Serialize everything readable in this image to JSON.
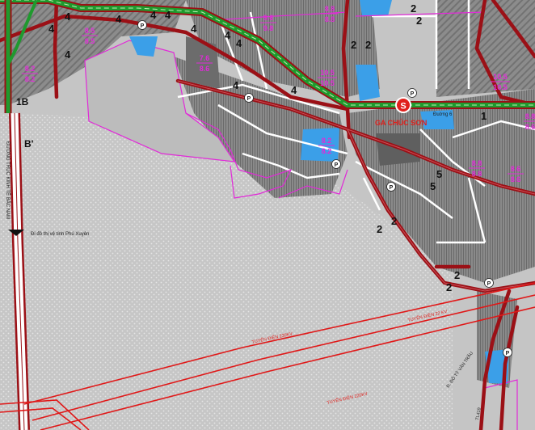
{
  "labels": {
    "station": "GA CHÚC SƠN",
    "station_symbol": "S",
    "street_small": "Đuờng 6",
    "area_note": "Đi đô thị vệ tinh Phú Xuyên",
    "highway_vertical": "ĐƯỜNG TRỤC KINH TẾ BẮC NAM",
    "powerline_1": "TUYẾN ĐIỆN 220KV",
    "powerline_2": "TUYẾN ĐIỆN 22 KV",
    "powerline_3": "TUYẾN ĐIỆN 220KV",
    "road_lower": "Đ. ĐÔ TỶ VĂN TRẦU",
    "road_lower_right": "TL419",
    "b_prime": "B'",
    "b_prefix": "1B"
  },
  "elevations": [
    {
      "id": "e1",
      "top": "9.6",
      "bottom": "9.8"
    },
    {
      "id": "e2",
      "top": "8.8",
      "bottom": "8.8"
    },
    {
      "id": "e3",
      "top": "8.5",
      "bottom": "8.5"
    },
    {
      "id": "e4",
      "top": "8.2",
      "bottom": "8.2"
    },
    {
      "id": "e5",
      "top": "7.6",
      "bottom": "8.6"
    },
    {
      "id": "e6",
      "top": "10.5",
      "bottom": "10.5"
    },
    {
      "id": "e7",
      "top": "10.5",
      "bottom": "10.5"
    },
    {
      "id": "e8",
      "top": "8.2",
      "bottom": "8.2"
    },
    {
      "id": "e9",
      "top": "8.8",
      "bottom": "8.8"
    },
    {
      "id": "e10",
      "top": "8.6",
      "bottom": "8.6"
    },
    {
      "id": "e11",
      "top": "8.8",
      "bottom": "8.6"
    }
  ],
  "lot_codes": [
    "4",
    "4",
    "4",
    "4",
    "4",
    "4",
    "4",
    "4",
    "2",
    "2",
    "4",
    "4",
    "4",
    "2",
    "2",
    "5",
    "5",
    "2",
    "2",
    "2",
    "2",
    "1"
  ],
  "parking_symbol": "P",
  "colors": {
    "background": "#c8c8c8",
    "block_dark": "#6f6f6f",
    "road_white": "#ffffff",
    "main_road_red": "#9b1016",
    "rail_green": "#1f9a2e",
    "boundary_magenta": "#e12ad8",
    "water": "#3b9fe8",
    "powerline": "#e01818"
  }
}
